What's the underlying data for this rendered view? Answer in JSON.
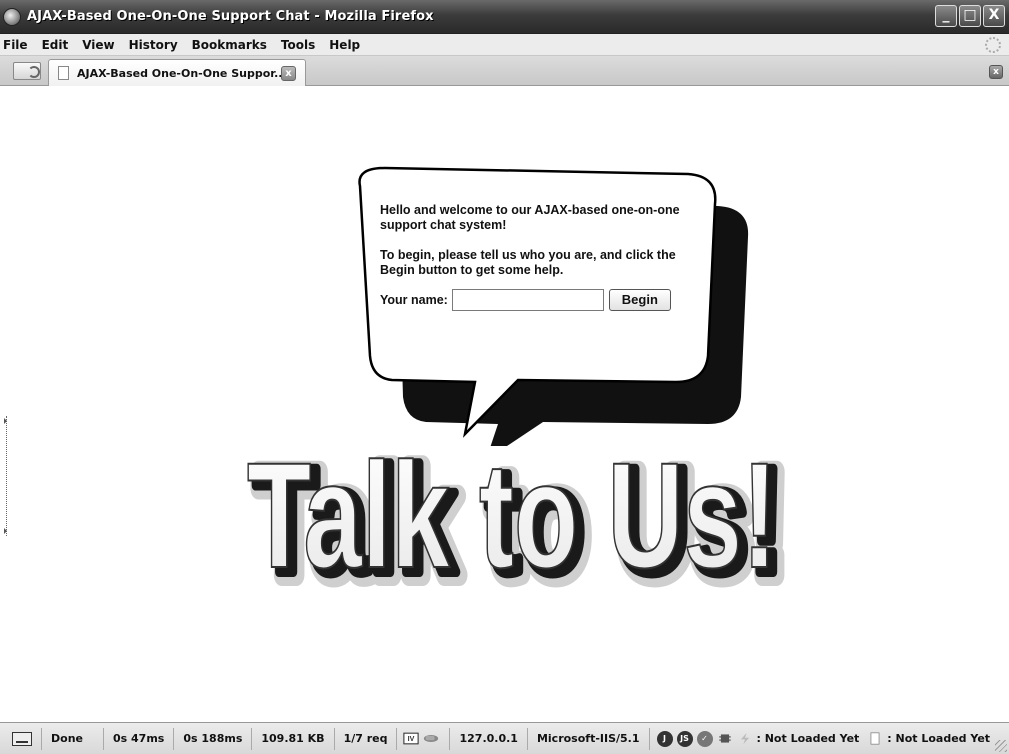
{
  "window": {
    "title": "AJAX-Based One-On-One Support Chat - Mozilla Firefox",
    "controls": {
      "minimize": "_",
      "maximize": "□",
      "close": "X"
    }
  },
  "menu": {
    "items": [
      "File",
      "Edit",
      "View",
      "History",
      "Bookmarks",
      "Tools",
      "Help"
    ]
  },
  "tabs": {
    "active_label": "AJAX-Based One-On-One Suppor...",
    "close_glyph": "x"
  },
  "page": {
    "greeting": "Hello and welcome to our AJAX-based one-on-one support chat system!",
    "instructions": "To begin, please tell us who you are, and click the Begin button to get some help.",
    "name_label": "Your name:",
    "name_value": "",
    "begin_label": "Begin",
    "banner_text": "Talk to Us!"
  },
  "status": {
    "state": "Done",
    "time_1": "0s 47ms",
    "time_2": "0s 188ms",
    "size": "109.81 KB",
    "requests": "1/7 req",
    "host": "127.0.0.1",
    "server": "Microsoft-IIS/5.1",
    "addon_1": ": Not Loaded Yet",
    "addon_2": ": Not Loaded Yet",
    "icons": [
      "status-page-icon",
      "iv-icon",
      "plugin-icon",
      "j-icon",
      "js-icon",
      "check-icon",
      "bug-icon",
      "lightning-icon",
      "page-blank-icon"
    ]
  }
}
